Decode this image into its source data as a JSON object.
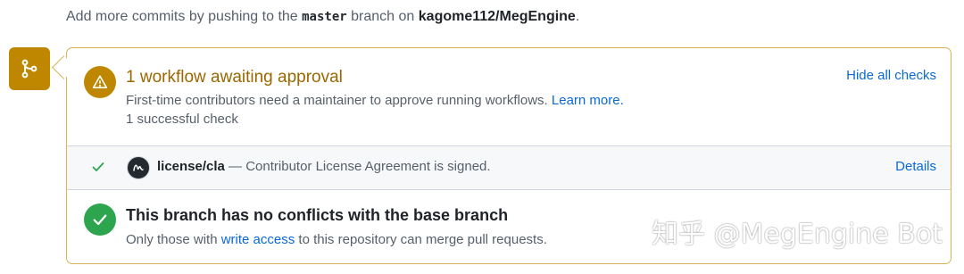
{
  "hint": {
    "prefix": "Add more commits by pushing to the ",
    "branch": "master",
    "middle": " branch on ",
    "repo": "kagome112/MegEngine",
    "suffix": "."
  },
  "workflow": {
    "title": "1 workflow awaiting approval",
    "desc": "First-time contributors need a maintainer to approve running workflows.",
    "learn_more": "Learn more.",
    "checks_summary": "1 successful check",
    "hide_checks": "Hide all checks"
  },
  "check": {
    "name": "license/cla",
    "desc": " — Contributor License Agreement is signed.",
    "details": "Details"
  },
  "merge": {
    "title": "This branch has no conflicts with the base branch",
    "sub_prefix": "Only those with ",
    "write_access": "write access",
    "sub_suffix": " to this repository can merge pull requests."
  },
  "watermark": "知乎 @MegEngine Bot",
  "colors": {
    "attention": "#bf8700",
    "success": "#2da44e",
    "link": "#0969da"
  },
  "icons": [
    "git-branch-icon",
    "alert-icon",
    "check-icon",
    "avatar",
    "check-circle-icon"
  ]
}
